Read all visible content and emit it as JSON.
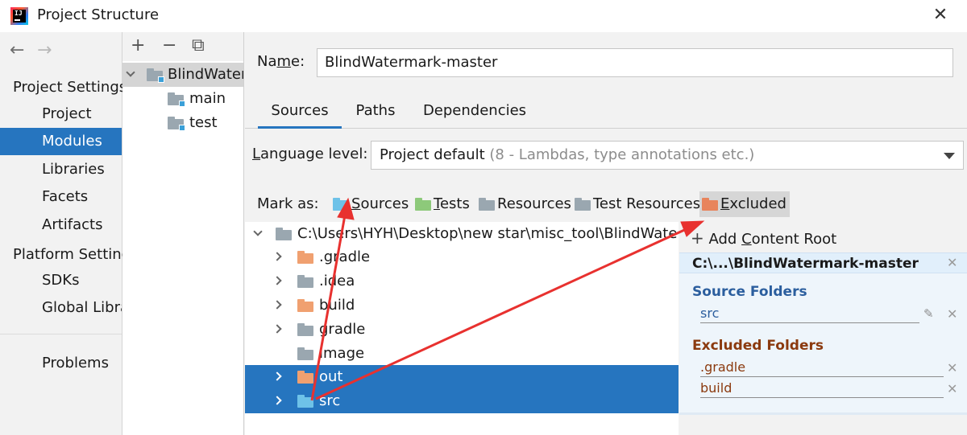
{
  "window": {
    "title": "Project Structure"
  },
  "nav": {
    "back": "←",
    "forward": "→",
    "project_settings": "Project Settings",
    "project_items": [
      "Project",
      "Modules",
      "Libraries",
      "Facets",
      "Artifacts"
    ],
    "selected": "Modules",
    "platform_settings": "Platform Settings",
    "platform_items": [
      "SDKs",
      "Global Libraries"
    ],
    "problems": "Problems"
  },
  "modules": {
    "toolbar": {
      "add": "+",
      "remove": "−",
      "copy": "⧉"
    },
    "root": "BlindWatermark-master",
    "children": [
      "main",
      "test"
    ]
  },
  "name": {
    "label_pre": "Na",
    "label_mnemonic": "m",
    "label_post": "e:",
    "value": "BlindWatermark-master"
  },
  "tabs": [
    "Sources",
    "Paths",
    "Dependencies"
  ],
  "active_tab": "Sources",
  "language": {
    "label_mnemonic": "L",
    "label_post": "anguage level:",
    "value": "Project default",
    "hint": "(8 - Lambdas, type annotations etc.)"
  },
  "mark_as": {
    "label": "Mark as:",
    "buttons": [
      {
        "mnemonic": "S",
        "rest": "ources",
        "color": "#6ec2e8"
      },
      {
        "mnemonic": "T",
        "rest": "ests",
        "color": "#8dc97a"
      },
      {
        "mnemonic": "",
        "rest": "Resources",
        "color": "#9aa7b0"
      },
      {
        "mnemonic": "",
        "rest": "Test Resources",
        "color": "#9aa7b0"
      },
      {
        "mnemonic": "E",
        "rest": "xcluded",
        "color": "#e8845c"
      }
    ]
  },
  "tree": {
    "root": "C:\\Users\\HYH\\Desktop\\new star\\misc_tool\\BlindWatermark-master",
    "rows": [
      {
        "name": ".gradle",
        "color": "orange",
        "expandable": true,
        "selected": false
      },
      {
        "name": ".idea",
        "color": "gray",
        "expandable": true,
        "selected": false
      },
      {
        "name": "build",
        "color": "orange",
        "expandable": true,
        "selected": false
      },
      {
        "name": "gradle",
        "color": "gray",
        "expandable": true,
        "selected": false
      },
      {
        "name": "image",
        "color": "gray",
        "expandable": false,
        "selected": false
      },
      {
        "name": "out",
        "color": "orange",
        "expandable": true,
        "selected": true
      },
      {
        "name": "src",
        "color": "blue",
        "expandable": true,
        "selected": true
      }
    ]
  },
  "content_roots": {
    "add_pre": "Add ",
    "add_mnemonic": "C",
    "add_post": "ontent Root",
    "root_label": "C:\\...\\BlindWatermark-master",
    "source_title": "Source Folders",
    "source_folders": [
      "src"
    ],
    "excluded_title": "Excluded Folders",
    "excluded_folders": [
      ".gradle",
      "build"
    ]
  },
  "colors": {
    "accent": "#2675bf",
    "annotation_arrow": "#e8312f"
  }
}
